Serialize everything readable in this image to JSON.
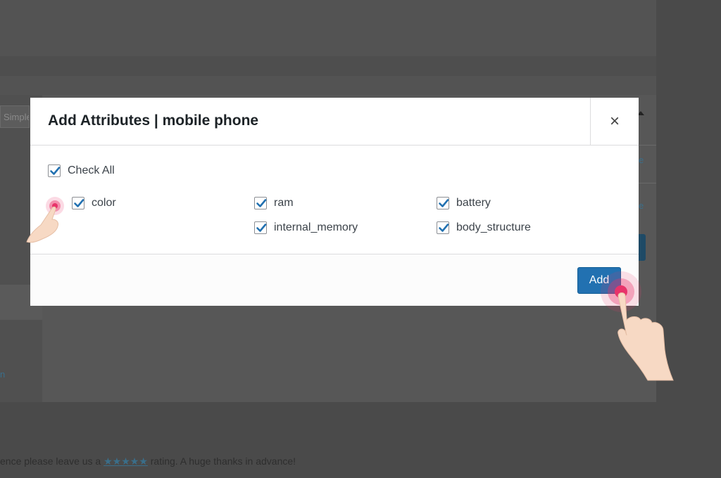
{
  "background": {
    "select_text": "Simple",
    "link_1": "e",
    "link_2": "e",
    "link_3": "n",
    "footer": {
      "before": "ence please leave us a ",
      "stars": "★★★★★",
      "after": " rating. A huge thanks in advance!"
    }
  },
  "modal": {
    "title": "Add Attributes | mobile phone",
    "close_icon": "×",
    "check_all_label": "Check All",
    "check_all_checked": true,
    "attributes": [
      {
        "label": "color",
        "checked": true
      },
      {
        "label": "ram",
        "checked": true
      },
      {
        "label": "internal_memory",
        "checked": true
      },
      {
        "label": "battery",
        "checked": true
      },
      {
        "label": "body_structure",
        "checked": true
      }
    ],
    "add_label": "Add"
  },
  "colors": {
    "primary_button": "#2271b1",
    "checkmark": "#2271b1",
    "pointer_highlight": "#e8336a"
  },
  "icons": {
    "checkmark": "checkmark-icon",
    "close": "close-icon",
    "pointer": "pointing-hand-icon"
  }
}
